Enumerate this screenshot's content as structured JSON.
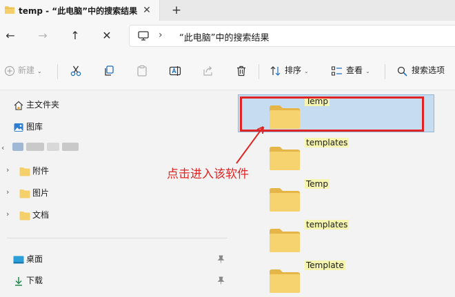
{
  "tab": {
    "title": "temp - “此电脑”中的搜索结果",
    "close_glyph": "✕",
    "add_glyph": "+"
  },
  "nav": {
    "back_glyph": "←",
    "forward_glyph": "→",
    "up_glyph": "↑",
    "close_glyph": "✕",
    "address_chevron": "›",
    "address_text": "“此电脑”中的搜索结果"
  },
  "commands": {
    "new_label": "新建",
    "sort_label": "排序",
    "view_label": "查看",
    "search_options_label": "搜索选项",
    "dropdown_glyph": "⌄"
  },
  "sidebar": {
    "home": "主文件夹",
    "gallery": "图库",
    "user_folders": [
      "附件",
      "图片",
      "文档"
    ],
    "desktop": "桌面",
    "downloads": "下载",
    "expander_glyph": "›",
    "collapse_glyph": "‹",
    "pin_glyph": "📌"
  },
  "results": [
    {
      "name": "Temp"
    },
    {
      "name": "templates"
    },
    {
      "name": "Temp"
    },
    {
      "name": "templates"
    },
    {
      "name": "Template"
    }
  ],
  "annotation": {
    "text": "点击进入该软件",
    "color": "#e02424"
  },
  "colors": {
    "folder": "#f4cf6a",
    "folder_dark": "#e6b548",
    "selection": "#c6ddf1",
    "accent": "#0067c0"
  }
}
